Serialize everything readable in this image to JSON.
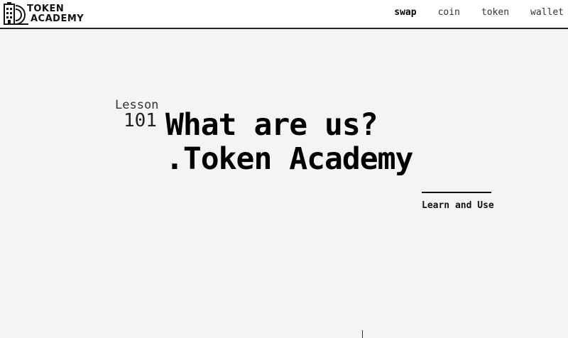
{
  "header": {
    "logo": {
      "line1": "TOKEN",
      "line2": "ACADEMY"
    },
    "nav": [
      {
        "label": "swap",
        "active": true
      },
      {
        "label": "coin",
        "active": false
      },
      {
        "label": "token",
        "active": false
      },
      {
        "label": "wallet",
        "active": false
      }
    ]
  },
  "hero": {
    "lesson_label": "Lesson",
    "lesson_number": "101",
    "title_line1": "What are us?",
    "title_line2": ".Token Academy",
    "cta_label": "Learn and Use"
  }
}
